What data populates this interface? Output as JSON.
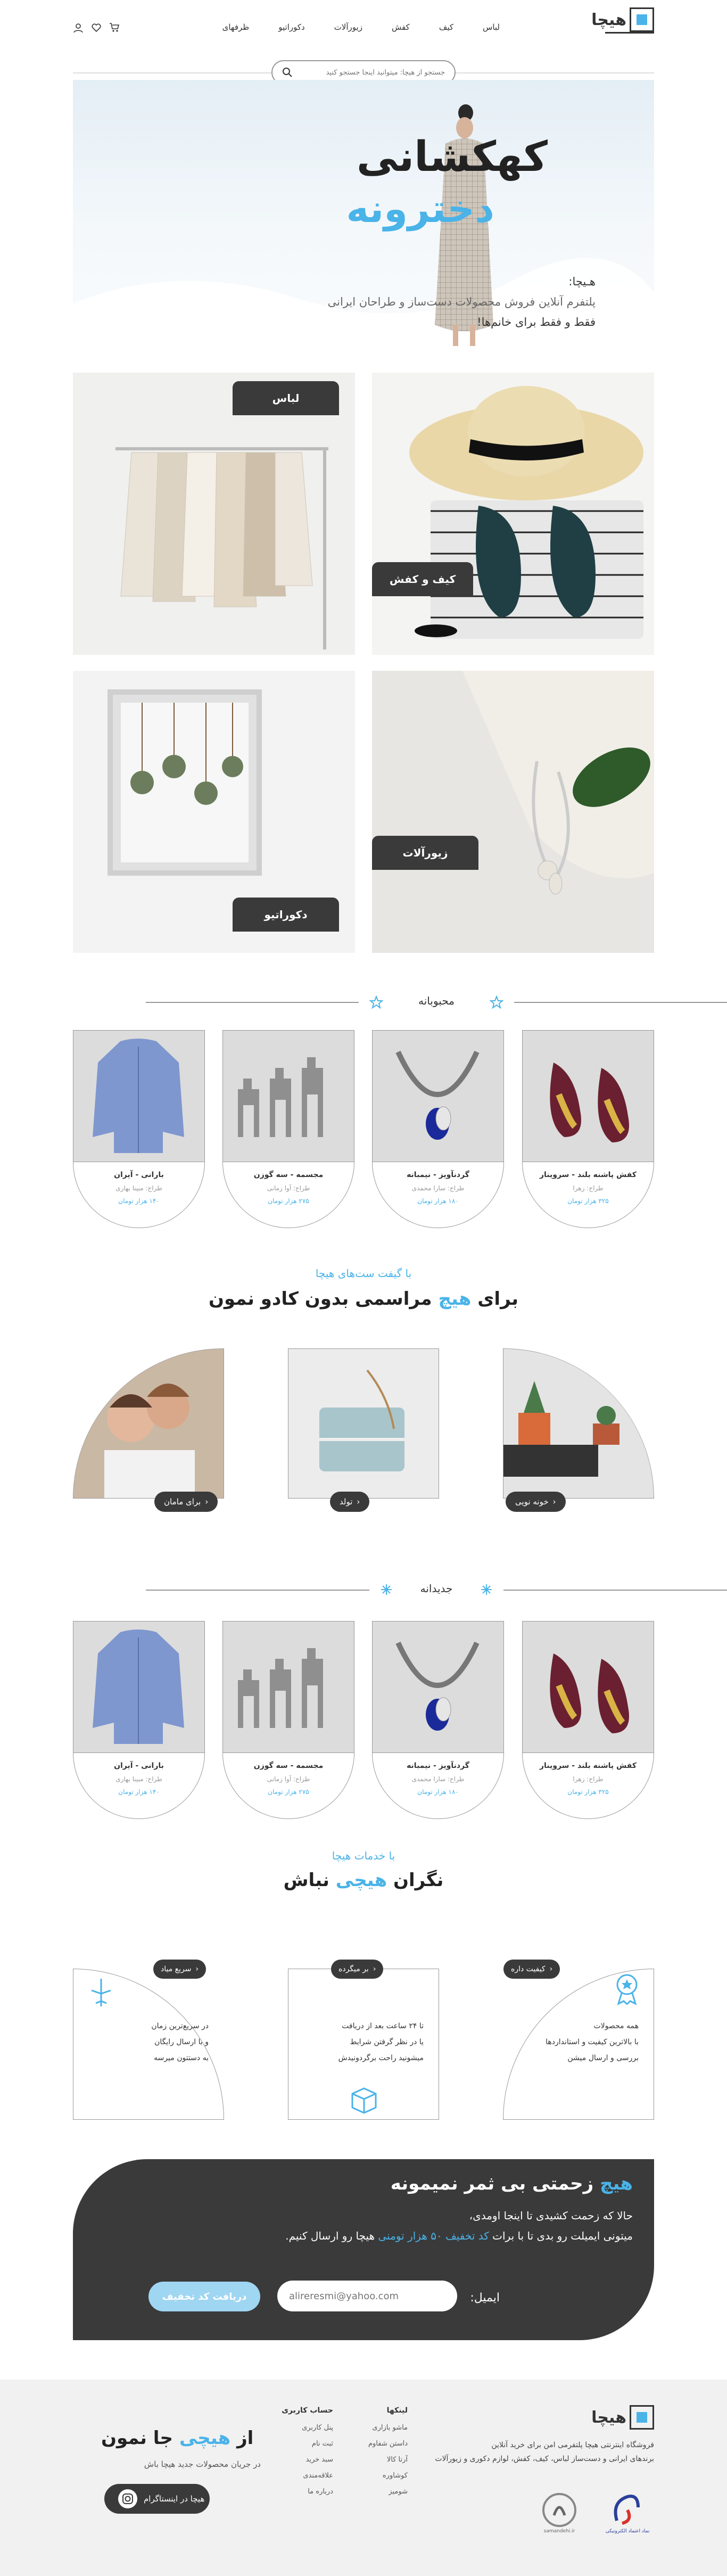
{
  "header": {
    "logo_text": "هیچا",
    "nav": [
      "لباس",
      "کیف",
      "کفش",
      "زیورآلات",
      "دکوراتیو",
      "ظرفهای"
    ],
    "search_placeholder": "جستجو از هیچا: ميتوانيد اينجا جستجو کنيد"
  },
  "hero": {
    "title": "کهکشانی",
    "subtitle": "دخترونه",
    "line1": "هـیچا:",
    "line2": "پلتفرم آنلاین فروش محصولات دست‌ساز و طراحان ایرانی",
    "line3": "فقط و فقط برای خانم‌ها!"
  },
  "categories": {
    "clothes": "لباس",
    "bags_shoes": "کیف و کفش",
    "decor": "دکوراتیو",
    "jewelry": "زیورآلات"
  },
  "popular": {
    "title": "محبوبانه",
    "products": [
      {
        "name": "کفش پاشنه بلند - سروینار",
        "designer": "طراح: زهرا",
        "price": "۳۲۵ هزار تومان"
      },
      {
        "name": "گردنآویز - نیمبانه",
        "designer": "طراح: سارا محمدی",
        "price": "۱۸۰ هزار تومان"
      },
      {
        "name": "مجسمه - سه گوزن",
        "designer": "طراح: آوا زمانی",
        "price": "۲۷۵ هزار تومان"
      },
      {
        "name": "بارانی - آیران",
        "designer": "طراح: مبینا بهاری",
        "price": "۱۴۰ هزار تومان"
      }
    ]
  },
  "gifts": {
    "tagline": "با گیفت ست‌های هیچا",
    "title_prefix": "برای",
    "title_highlight": "هیچ",
    "title_suffix": "مراسمی بدون کادو نمون",
    "cards": [
      {
        "label": "خونه نویی"
      },
      {
        "label": "تولد"
      },
      {
        "label": "برای مامان"
      }
    ]
  },
  "newest": {
    "title": "جدیدانه",
    "products": [
      {
        "name": "کفش پاشنه بلند - سروینار",
        "designer": "طراح: زهرا",
        "price": "۳۲۵ هزار تومان"
      },
      {
        "name": "گردنآویز - نیمبانه",
        "designer": "طراح: سارا محمدی",
        "price": "۱۸۰ هزار تومان"
      },
      {
        "name": "مجسمه - سه گوزن",
        "designer": "طراح: آوا زمانی",
        "price": "۲۷۵ هزار تومان"
      },
      {
        "name": "بارانی - آیران",
        "designer": "طراح: مبینا بهاری",
        "price": "۱۴۰ هزار تومان"
      }
    ]
  },
  "services": {
    "tagline": "با خدمات هیچا",
    "title_prefix": "نگران",
    "title_highlight": "هیچی",
    "title_suffix": "نباش",
    "items": [
      {
        "badge": "کیفیت داره",
        "lines": [
          "همه محصولات",
          "با بالاترین کیفیت و استانداردها",
          "بررسی و ارسال میشن"
        ]
      },
      {
        "badge": "بر میگرده",
        "lines": [
          "تا ۲۴ ساعت بعد از دریافت",
          "یا در نظر گرفتن شرایط",
          "میشونید راحت برگردونیدش"
        ]
      },
      {
        "badge": "سریع میاد",
        "lines": [
          "در سریع‌ترین زمان",
          "و با ارسال رایگان",
          "به دستتون میرسه"
        ]
      }
    ]
  },
  "banner": {
    "title_highlight": "هیچ",
    "title_rest": "زحمتی بی ثمر نمیمونه",
    "line1": "حالا که زحمت کشیدی تا اینجا اومدی،",
    "line2_pre": "میتونی ایمیلت رو بدی تا با برات",
    "line2_highlight": "کد تخفیف ۵۰ هزار تومنی",
    "line2_post": "هیچا رو ارسال کنیم.",
    "email_label": "ایمیل:",
    "email_placeholder": "alireresmi@yahoo.com",
    "button": "دریافت کد تخفیف"
  },
  "footer": {
    "logo_text": "هیچا",
    "about": [
      "فروشگاه اینترنتی هیچا پلتفرمی امن برای خرید آنلاین",
      "برندهای ایرانی و دست‌ساز لباس، کیف، کفش، لوازم دکوری و زیورآلات"
    ],
    "col_links_title": "لینکها",
    "col_links": [
      "ماشو بازاری",
      "داستن شفاوم",
      "آرتا کالا",
      "کوشاوره",
      "شومیز"
    ],
    "col_account_title": "حساب کاربری",
    "col_account": [
      "پنل کاربری",
      "ثبت نام",
      "سبد خرید",
      "علاقه‌مندی",
      "درباره ما"
    ],
    "cta_pre": "از",
    "cta_highlight": "هیچی",
    "cta_post": "جا نمون",
    "cta_sub": "در جریان محصولات جدید هیچا باش",
    "cta_button": "هیچا در اینستاگرام",
    "badge_enamad": "نماد اعتماد الکترونیکی",
    "badge_samandehi": "samandehi.ir"
  },
  "colors": {
    "accent": "#4ab3e8",
    "dark": "#3a3a3a",
    "footer_bg": "#f1f1f1"
  }
}
